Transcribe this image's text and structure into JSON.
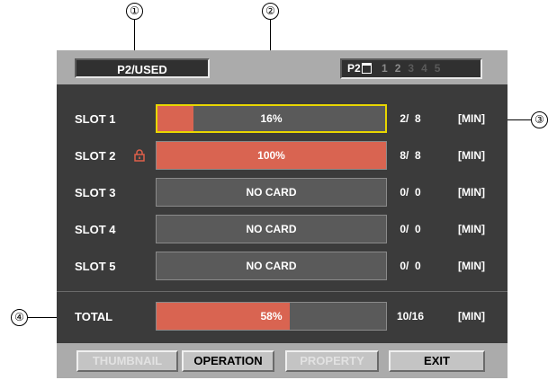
{
  "callouts": [
    "①",
    "②",
    "③",
    "④"
  ],
  "header": {
    "title": "P2/USED",
    "p2_label": "P2",
    "slot_numbers": [
      "1",
      "2",
      "3",
      "4",
      "5"
    ]
  },
  "slots": [
    {
      "label": "SLOT 1",
      "status": "16%",
      "fill": 0.16,
      "count": " 2/  8",
      "unit": "[MIN]",
      "locked": false,
      "selected": true
    },
    {
      "label": "SLOT 2",
      "status": "100%",
      "fill": 1.0,
      "count": " 8/  8",
      "unit": "[MIN]",
      "locked": true,
      "selected": false
    },
    {
      "label": "SLOT 3",
      "status": "NO CARD",
      "fill": 0,
      "count": " 0/  0",
      "unit": "[MIN]",
      "locked": false,
      "selected": false
    },
    {
      "label": "SLOT 4",
      "status": "NO CARD",
      "fill": 0,
      "count": " 0/  0",
      "unit": "[MIN]",
      "locked": false,
      "selected": false
    },
    {
      "label": "SLOT 5",
      "status": "NO CARD",
      "fill": 0,
      "count": " 0/  0",
      "unit": "[MIN]",
      "locked": false,
      "selected": false
    }
  ],
  "total": {
    "label": "TOTAL",
    "status": "58%",
    "fill": 0.58,
    "count": "10/16",
    "unit": "[MIN]"
  },
  "tabs": [
    {
      "label": "THUMBNAIL",
      "enabled": false
    },
    {
      "label": "OPERATION",
      "enabled": true
    },
    {
      "label": "PROPERTY",
      "enabled": false
    },
    {
      "label": "EXIT",
      "enabled": true
    }
  ],
  "colors": {
    "fill": "#d96451",
    "selection": "#e8d600",
    "lock": "#e0604a",
    "screen_bg": "#3b3b3b",
    "bar_bg": "#5a5a5a"
  }
}
